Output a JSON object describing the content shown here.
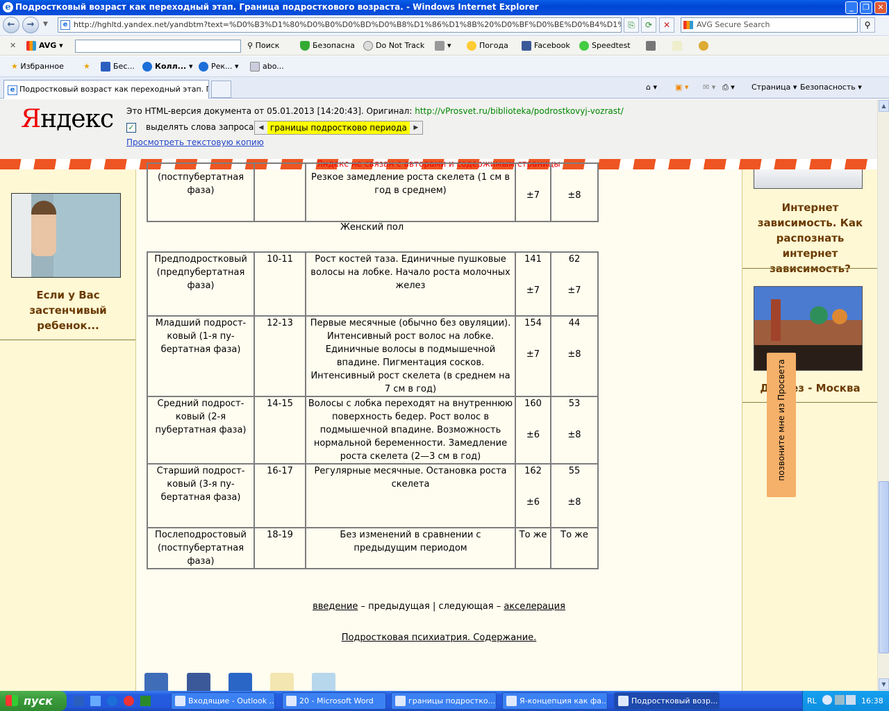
{
  "window": {
    "title": "Подростковый возраст как переходный этап. Граница подросткового возраста. - Windows Internet Explorer"
  },
  "addressbar": {
    "url": "http://hghltd.yandex.net/yandbtm?text=%D0%B3%D1%80%D0%B0%D0%BD%D0%B8%D1%86%D1%8B%20%D0%BF%D0%BE%D0%B4%D1%80%D0",
    "search_placeholder": "AVG Secure Search"
  },
  "avg_toolbar": {
    "avg_label": "AVG",
    "search_label": "Поиск",
    "safe_label": "Безопасна",
    "dnt_label": "Do Not Track",
    "weather_label": "Погода",
    "facebook_label": "Facebook",
    "speedtest_label": "Speedtest"
  },
  "favorites_bar": {
    "favorites_label": "Избранное",
    "items": [
      "Бес...",
      "Колл...",
      "Рек...",
      "abo..."
    ]
  },
  "tabs": {
    "active_tab": "Подростковый возраст как переходный этап. Гра...",
    "page_menu": "Страница",
    "safety_menu": "Безопасность"
  },
  "yandex": {
    "logo_red": "Я",
    "logo_rest": "ндекс",
    "info_prefix": "Это HTML-версия документа от 05.01.2013 [14:20:43]. Оригинал: ",
    "original_link": "http://vProsvet.ru/biblioteka/podrostkovyj-vozrast/",
    "highlight_label": "выделять слова запроса:",
    "query": "границы подростково периода",
    "text_copy_link": "Просмотреть текстовую копию",
    "disclaimer": "Яндекс не связан с авторами и содержимым страницы"
  },
  "left_sidebar": {
    "shy_child_link": "Если у Вас застенчивый ребенок..."
  },
  "right_sidebar": {
    "internet_link": "Интернет зависимость. Как распознать интернет зависимость?",
    "moscow_link": "Досуг-тез - Москва",
    "moscow_visible": "Д      ез - Москва"
  },
  "call_tab": "позвоните мне из Просвета",
  "table_top": {
    "phase": "(постпубертатная фаза)",
    "desc": "Резкое замедление роста скелета (1 см в год в среднем)",
    "height_sd": "±7",
    "weight_sd": "±8"
  },
  "female_label": "Женский пол",
  "rows": [
    {
      "phase": "Предподростковый (предпубертатная фаза)",
      "age": "10-11",
      "desc": "Рост костей таза. Единичные пушковые волосы на лобке. Начало роста молочных желез",
      "height": "141",
      "height_sd": "±7",
      "weight": "62",
      "weight_sd": "±7"
    },
    {
      "phase": "Младший подрост-ковый (1-я пу-бертатная фаза)",
      "age": "12-13",
      "desc": "Первые месячные (обычно без овуляции). Интенсивный рост волос на лобке. Единичные волосы в подмышечной впадине. Пигментация сосков. Интенсивный рост скелета (в среднем на 7 см в год)",
      "height": "154",
      "height_sd": "±7",
      "weight": "44",
      "weight_sd": "±8"
    },
    {
      "phase": "Средний подрост-ковый (2-я пубертатная фаза)",
      "age": "14-15",
      "desc": "Волосы с лобка переходят на внутреннюю поверхность бедер. Рост волос в подмышечной впадине. Возможность нормальной беременности. Замедление роста скелета (2—3 см в год)",
      "height": "160",
      "height_sd": "±6",
      "weight": "53",
      "weight_sd": "±8"
    },
    {
      "phase": "Старший подрост-ковый (3-я пу-бертатная фаза)",
      "age": "16-17",
      "desc": "Регулярные месячные. Остановка роста скелета",
      "height": "162",
      "height_sd": "±6",
      "weight": "55",
      "weight_sd": "±8"
    },
    {
      "phase": "Послеподростовый (постпубертатная фаза)",
      "age": "18-19",
      "desc": "Без изменений в сравнении с предыдущим периодом",
      "height": "То же",
      "height_sd": "",
      "weight": "То же",
      "weight_sd": ""
    }
  ],
  "pager": {
    "prev_link": "введение",
    "prev_text": " – предыдущая | следующая – ",
    "next_link": "акселерация"
  },
  "toc_link": "Подростковая психиатрия. Содержание.",
  "taskbar": {
    "start": "пуск",
    "tasks": [
      "Входящие - Outlook ...",
      "20 - Microsoft Word",
      "границы подростко...",
      "Я-концепция как фа...",
      "Подростковый возр..."
    ],
    "lang": "RL",
    "clock": "16:38"
  }
}
